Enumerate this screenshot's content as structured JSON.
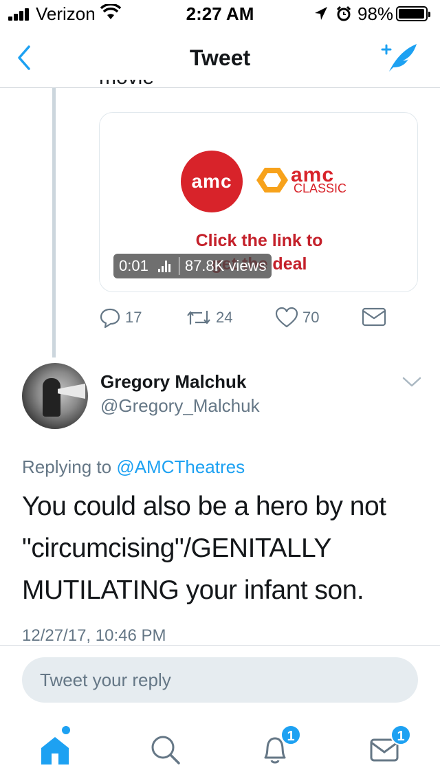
{
  "status_bar": {
    "carrier": "Verizon",
    "time": "2:27 AM",
    "battery_percent": "98%",
    "battery_level": 0.98
  },
  "nav": {
    "title": "Tweet",
    "back_icon": "chevron-left-icon",
    "compose_icon": "compose-feather-icon"
  },
  "quoted_tweet": {
    "card": {
      "logo_text": "amc",
      "classic_logo_text": "amc",
      "classic_label": "CLASSIC",
      "cta_line1": "Click the link to",
      "cta_line2": "get the deal",
      "video_time": "0:01",
      "video_views": "87.8K views"
    },
    "actions": {
      "replies": "17",
      "retweets": "24",
      "likes": "70"
    }
  },
  "reply_tweet": {
    "author_name": "Gregory Malchuk",
    "author_handle": "@Gregory_Malchuk",
    "replying_prefix": "Replying to",
    "replying_to": "@AMCTheatres",
    "body": "You could also be a hero by not \"circumcising\"/GENITALLY MUTILATING your infant son.",
    "timestamp": "12/27/17, 10:46 PM"
  },
  "reply_box": {
    "placeholder": "Tweet your reply"
  },
  "tab_bar": {
    "notifications_badge": "1",
    "messages_badge": "1"
  },
  "colors": {
    "accent": "#1da1f2",
    "brand_red": "#d8232a",
    "secondary_text": "#657786"
  }
}
